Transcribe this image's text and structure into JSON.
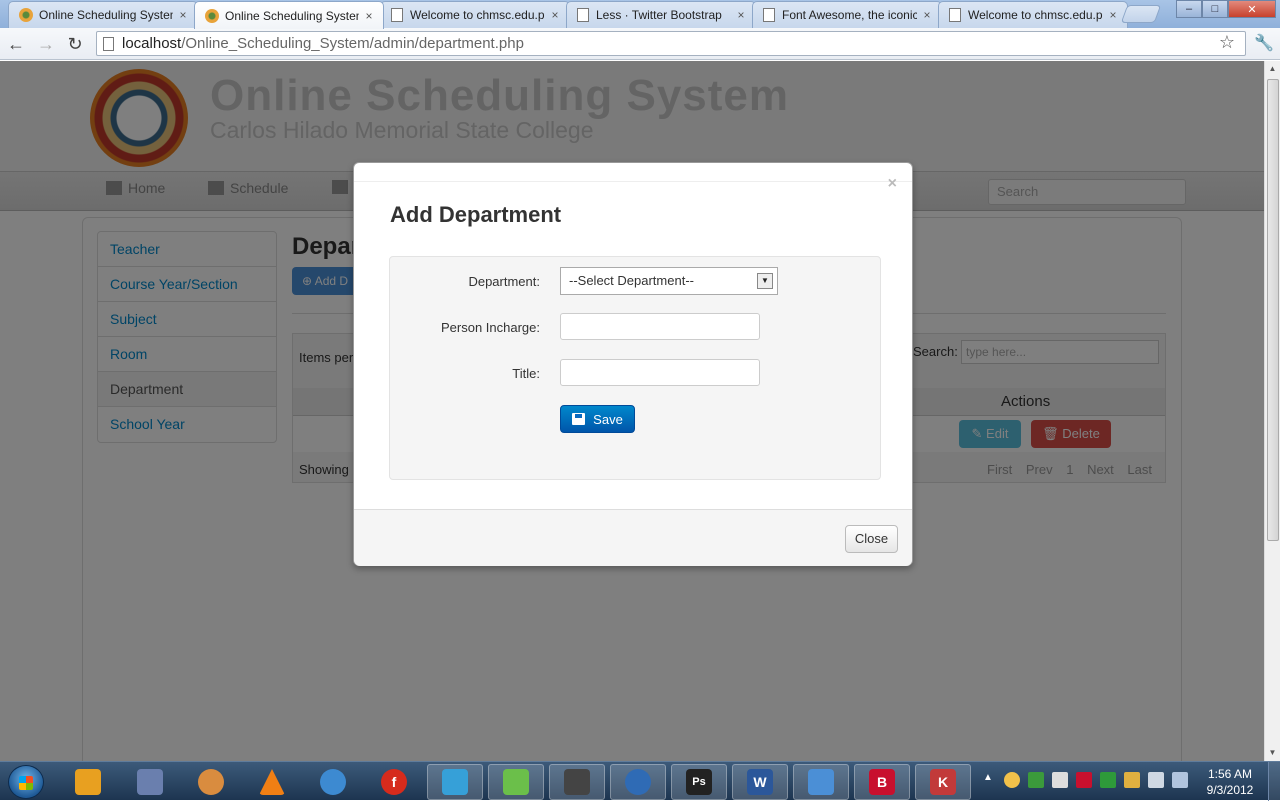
{
  "browser": {
    "tabs": [
      {
        "label": "Online Scheduling System",
        "icon": "site-favicon",
        "active": false
      },
      {
        "label": "Online Scheduling System",
        "icon": "site-favicon",
        "active": true
      },
      {
        "label": "Welcome to chmsc.edu.ph",
        "icon": "page-icon",
        "active": false
      },
      {
        "label": "Less · Twitter Bootstrap",
        "icon": "page-icon",
        "active": false
      },
      {
        "label": "Font Awesome, the iconic",
        "icon": "page-icon",
        "active": false
      },
      {
        "label": "Welcome to chmsc.edu.ph",
        "icon": "page-icon",
        "active": false
      }
    ],
    "tab_close": "×",
    "url_host": "localhost",
    "url_path": "/Online_Scheduling_System/admin/department.php",
    "window_controls": {
      "minimize": "–",
      "maximize": "□",
      "close": "✕"
    }
  },
  "site": {
    "title": "Online Scheduling System",
    "subtitle": "Carlos Hilado Memorial State College",
    "nav": {
      "home": "Home",
      "schedule": "Schedule"
    },
    "search_placeholder": "Search"
  },
  "sidebar": {
    "items": [
      {
        "label": "Teacher"
      },
      {
        "label": "Course Year/Section"
      },
      {
        "label": "Subject"
      },
      {
        "label": "Room"
      },
      {
        "label": "Department"
      },
      {
        "label": "School Year"
      }
    ],
    "active_index": 4
  },
  "main": {
    "title": "Depar",
    "add_button": "Add D",
    "table": {
      "items_per_page": "Items per",
      "search_label": "Search:",
      "search_placeholder": "type here...",
      "actions_header": "Actions",
      "edit_label": "Edit",
      "delete_label": "Delete",
      "showing": "Showing",
      "pager": "First Prev 1 Next Last"
    }
  },
  "modal": {
    "title": "Add Department",
    "close_x": "×",
    "fields": {
      "department_label": "Department:",
      "department_selected": "--Select Department--",
      "person_label": "Person Incharge:",
      "person_value": "",
      "title_label": "Title:",
      "title_value": ""
    },
    "save_label": "Save",
    "close_label": "Close"
  },
  "taskbar": {
    "clock_time": "1:56 AM",
    "clock_date": "9/3/2012",
    "apps": [
      "file-manager-icon",
      "media-icon",
      "paint-icon",
      "vlc-icon",
      "window-icon",
      "flash-icon",
      "app-icon",
      "notepad-icon",
      "gaming-icon",
      "ie-icon",
      "photoshop-icon",
      "word-icon",
      "network-icon",
      "bitdefender-icon",
      "bbedit-icon"
    ]
  },
  "colors": {
    "primary": "#0088cc",
    "danger": "#da4f49",
    "info": "#5bc0de",
    "overlay": "rgba(0,0,0,0.5)"
  }
}
